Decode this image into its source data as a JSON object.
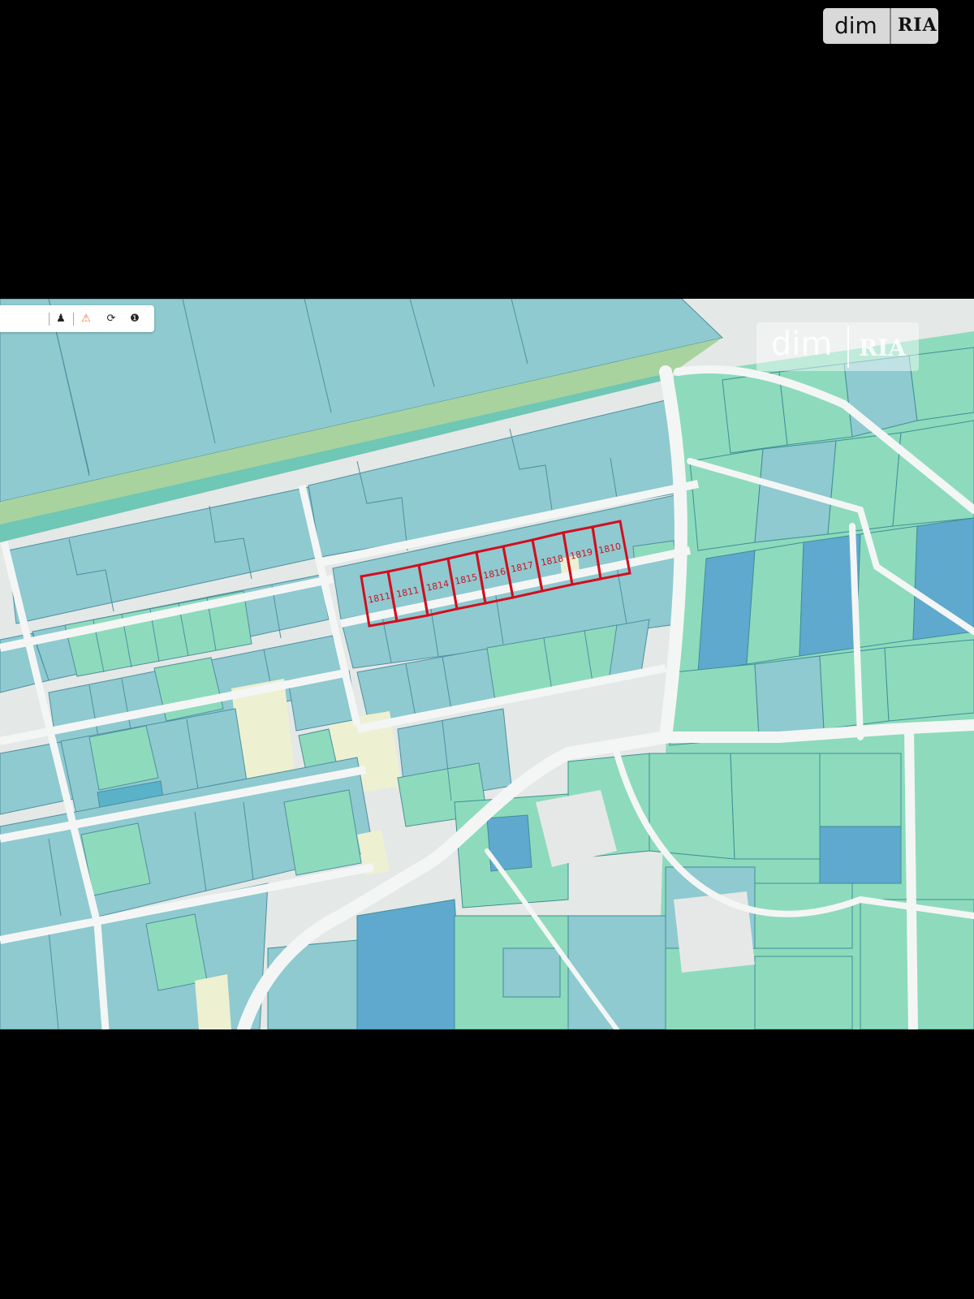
{
  "watermark_badge": {
    "brand_left": "dim",
    "brand_right": "RIA"
  },
  "map": {
    "toolbar": {
      "tools": [
        {
          "icon": "pin-icon",
          "glyph": "♟"
        },
        {
          "icon": "warning-icon",
          "glyph": "⚠"
        },
        {
          "icon": "refresh-icon",
          "glyph": "⟳"
        },
        {
          "icon": "info-icon",
          "glyph": "❶"
        }
      ]
    },
    "highlighted_parcels": [
      "1811",
      "1811",
      "1814",
      "1815",
      "1816",
      "1817",
      "1818",
      "1819",
      "1810"
    ],
    "colors": {
      "parcel_blue": "#8ecad0",
      "parcel_green": "#8ddbbc",
      "parcel_dark": "#5ab2c9",
      "road": "#f2f4f3",
      "empty_lot": "#eef0d2",
      "highlight": "#d10f1f"
    }
  }
}
